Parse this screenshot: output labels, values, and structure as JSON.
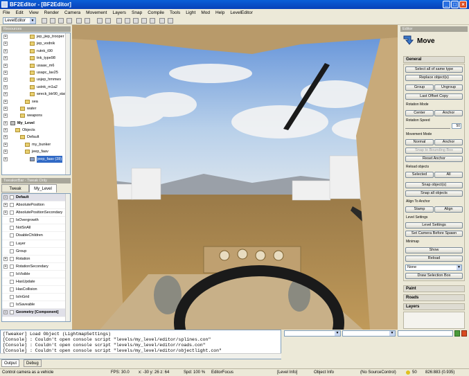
{
  "window": {
    "title": "BF2Editor - [BF2Editor]"
  },
  "menu": [
    "File",
    "Edit",
    "View",
    "Render",
    "Camera",
    "Movement",
    "Layers",
    "Snap",
    "Compile",
    "Tools",
    "Light",
    "Mod",
    "Help",
    "LevelEditor"
  ],
  "toolbar": {
    "editor_select": "LevelEditor"
  },
  "left_top": {
    "header": "Resources",
    "items": [
      {
        "label": "jep_jiep_trooper",
        "indent": 4,
        "folder": true
      },
      {
        "label": "jep_vodnik",
        "indent": 4,
        "folder": true
      },
      {
        "label": "rutnk_t90",
        "indent": 4,
        "folder": true
      },
      {
        "label": "tnk_type98",
        "indent": 4,
        "folder": true
      },
      {
        "label": "usaav_m6",
        "indent": 4,
        "folder": true
      },
      {
        "label": "usapc_lav25",
        "indent": 4,
        "folder": true
      },
      {
        "label": "usjep_hmmwv",
        "indent": 4,
        "folder": true
      },
      {
        "label": "ustnk_m1a2",
        "indent": 4,
        "folder": true
      },
      {
        "label": "wreck_btr90_static",
        "indent": 4,
        "folder": true
      },
      {
        "label": "sea",
        "indent": 3,
        "folder": true
      },
      {
        "label": "water",
        "indent": 2,
        "folder": true
      },
      {
        "label": "weapons",
        "indent": 2,
        "folder": true
      },
      {
        "label": "My_Level",
        "indent": 0,
        "folder": false,
        "bold": true
      },
      {
        "label": "Objects",
        "indent": 1,
        "folder": true
      },
      {
        "label": "Default",
        "indent": 2,
        "folder": true
      },
      {
        "label": "my_bunker",
        "indent": 3,
        "folder": true
      },
      {
        "label": "jeep_faav",
        "indent": 3,
        "folder": true
      },
      {
        "label": "jeep_faav (28)",
        "indent": 4,
        "folder": false,
        "selected": true
      }
    ]
  },
  "left_bottom": {
    "header": "TweakerBar - Tweak Only",
    "tabs": [
      "Tweak",
      "My_Level"
    ],
    "rows": [
      {
        "label": "Default",
        "bold": true,
        "pm": "-"
      },
      {
        "label": "AbsolutePosition",
        "pm": "+"
      },
      {
        "label": "AbsolutePositionSecondary",
        "pm": "+"
      },
      {
        "label": "IsOvergrowth",
        "pm": ""
      },
      {
        "label": "NotSnAll",
        "pm": ""
      },
      {
        "label": "DisableChildren",
        "pm": ""
      },
      {
        "label": "Layer",
        "pm": ""
      },
      {
        "label": "Group",
        "pm": ""
      },
      {
        "label": "Rotation",
        "pm": "+"
      },
      {
        "label": "RotationSecondary",
        "pm": "+"
      },
      {
        "label": "IsVisible",
        "pm": ""
      },
      {
        "label": "HasUpdate",
        "pm": ""
      },
      {
        "label": "HasCollision",
        "pm": ""
      },
      {
        "label": "IsInGrid",
        "pm": ""
      },
      {
        "label": "IsSaveable",
        "pm": ""
      },
      {
        "label": "Geometry [Component]",
        "bold": true,
        "pm": "-"
      }
    ]
  },
  "right_panel": {
    "header": "Editor",
    "title": "Move",
    "general": "General",
    "buttons": {
      "select_all_same": "Select all of same type",
      "replace": "Replace object(s)",
      "group": "Group",
      "ungroup": "Ungroup",
      "last_offset": "Last Offset Copy",
      "center": "Center",
      "anchor": "Anchor",
      "normal": "Normal",
      "anchor2": "Anchor",
      "snap_bbox": "Snap to Bounding Box",
      "reset_anchor": "Reset Anchor",
      "selected": "Selected",
      "all": "All",
      "snap_objects": "Snap object(s)",
      "snap_all": "Snap all objects",
      "stamp": "Stamp",
      "align": "Align",
      "level_settings": "Level Settings",
      "set_camera": "Set Camera Before Spawn",
      "show": "Show",
      "reload": "Reload",
      "draw_sel": "Draw Selection Box"
    },
    "labels": {
      "rotation_mode": "Rotation Mode",
      "rotation_speed": "Rotation Speed",
      "rotation_speed_value": "50",
      "movement_mode": "Movement Mode",
      "reload_objects": "Reload objects",
      "align_to_anchor": "Align To Anchor",
      "level_settings": "Level Settings",
      "minimap": "Minimap",
      "minimap_select": "None"
    },
    "groups": [
      "Paint",
      "Roads",
      "Layers"
    ]
  },
  "console": {
    "lines": [
      "[Tweaker] Load Object (LightmapSettings)",
      "[Console] : Couldn't open console script \"levels/my_level/editor/splines.con\"",
      "[Console] : Couldn't open console script \"levels/my_level/editor/roads.con\"",
      "[Console] : Couldn't open console script \"levels/my_level/editor/objectlight.con\""
    ],
    "tabs": [
      "Output",
      "Debug"
    ]
  },
  "status": {
    "msg": "Control camera as a vehicle",
    "fps": "FPS: 30.0",
    "coords": "x: -30 y: 26 z: 64",
    "spd": "Spd: 100 %",
    "focus": "EditorFocus",
    "level": "[Level Info]",
    "obj": "Object Info",
    "src": "(No SourceControl)",
    "num": "50",
    "mem": "826:883 (0.935)"
  },
  "colors": {
    "sky": "#8fb8e8",
    "ground": "#b08a4c",
    "vehicle": "#c8aa7a",
    "accent": "#0a5fd8"
  }
}
